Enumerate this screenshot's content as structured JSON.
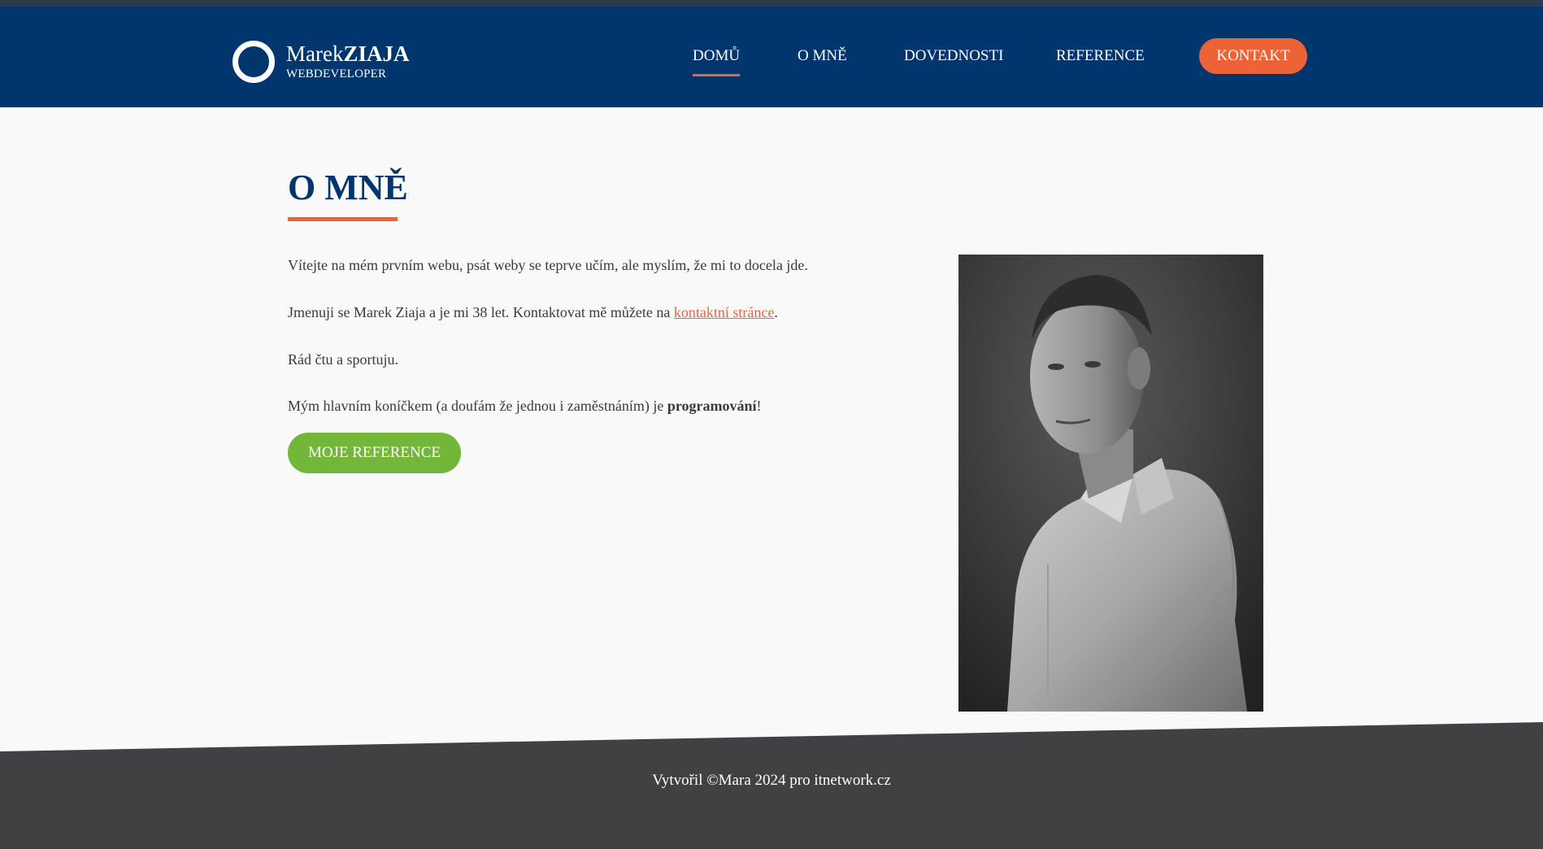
{
  "header": {
    "logo": {
      "first_name": "Marek",
      "last_name": "ZIAJA",
      "subtitle": "WEBDEVELOPER"
    },
    "nav": [
      {
        "label": "DOMŮ",
        "active": true
      },
      {
        "label": "O MNĚ",
        "active": false
      },
      {
        "label": "DOVEDNOSTI",
        "active": false
      },
      {
        "label": "REFERENCE",
        "active": false
      }
    ],
    "cta_label": "KONTAKT"
  },
  "main": {
    "title": "O MNĚ",
    "paragraphs": {
      "p1": "Vítejte na mém prvním webu, psát weby se teprve učím, ale myslím, že mi to docela jde.",
      "p2_before": "Jmenuji se Marek Ziaja a je mi 38 let. Kontaktovat mě můžete na ",
      "p2_link": "kontaktní stránce",
      "p2_after": ".",
      "p3": "Rád čtu a sportuju.",
      "p4_before": "Mým hlavním koníčkem (a doufám že jednou i zaměstnáním) je ",
      "p4_bold": "programování",
      "p4_after": "!"
    },
    "button_label": "MOJE REFERENCE",
    "photo_icon": "portrait-photo"
  },
  "footer": {
    "text": "Vytvořil ©Mara 2024 pro itnetwork.cz"
  },
  "colors": {
    "header_bg": "#00356e",
    "accent_orange": "#ee6335",
    "button_green": "#72b63a",
    "footer_bg": "#414143",
    "page_bg": "#f9f9f9"
  }
}
